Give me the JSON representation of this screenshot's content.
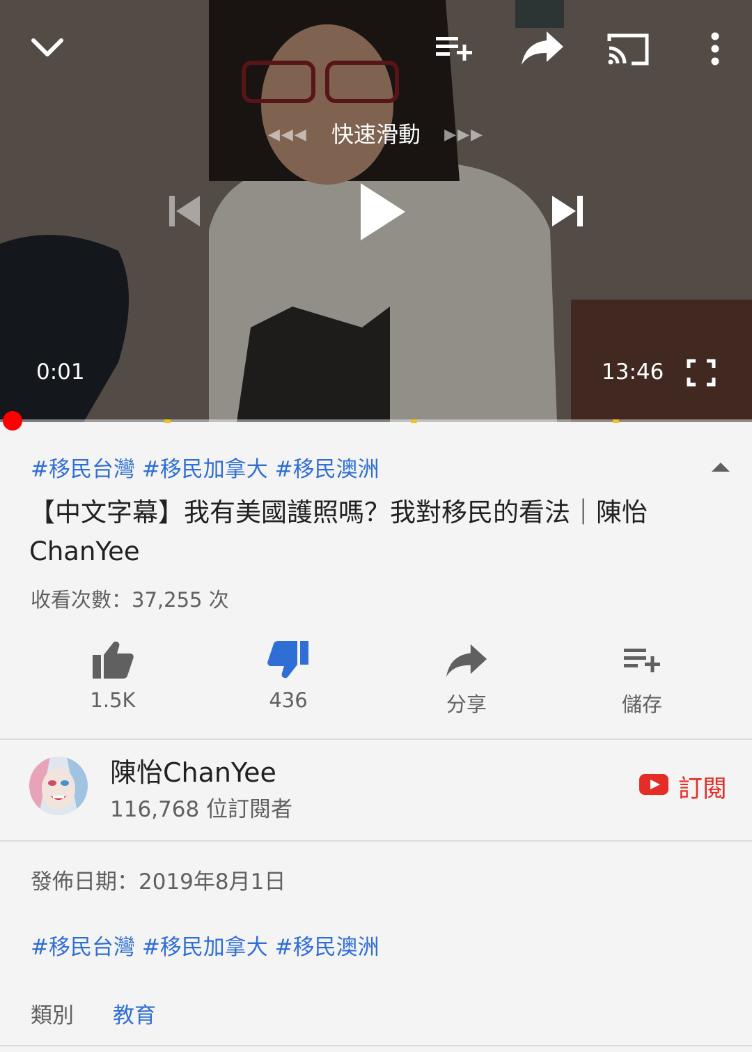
{
  "player": {
    "scrub_label": "快速滑動",
    "current_time": "0:01",
    "duration": "13:46",
    "progress_fraction": 0.001,
    "chapter_marks": [
      0.22,
      0.55,
      0.82
    ]
  },
  "video": {
    "hashtags_top": "#移民台灣 #移民加拿大 #移民澳洲",
    "title": "【中文字幕】我有美國護照嗎？我對移民的看法｜陳怡 ChanYee",
    "views": "收看次數：37,255 次"
  },
  "actions": {
    "like_count": "1.5K",
    "dislike_count": "436",
    "share_label": "分享",
    "save_label": "儲存"
  },
  "channel": {
    "name": "陳怡ChanYee",
    "subscribers": "116,768 位訂閱者",
    "subscribe_label": "訂閱"
  },
  "description": {
    "publish_date": "發佈日期：2019年8月1日",
    "hashtags": "#移民台灣 #移民加拿大 #移民澳洲",
    "category_label": "類別",
    "category_value": "教育"
  },
  "colors": {
    "accent_blue": "#2f6ed5",
    "youtube_red": "#e52d27",
    "progress_red": "#ff0000",
    "chapter_yellow": "#f0c419"
  }
}
